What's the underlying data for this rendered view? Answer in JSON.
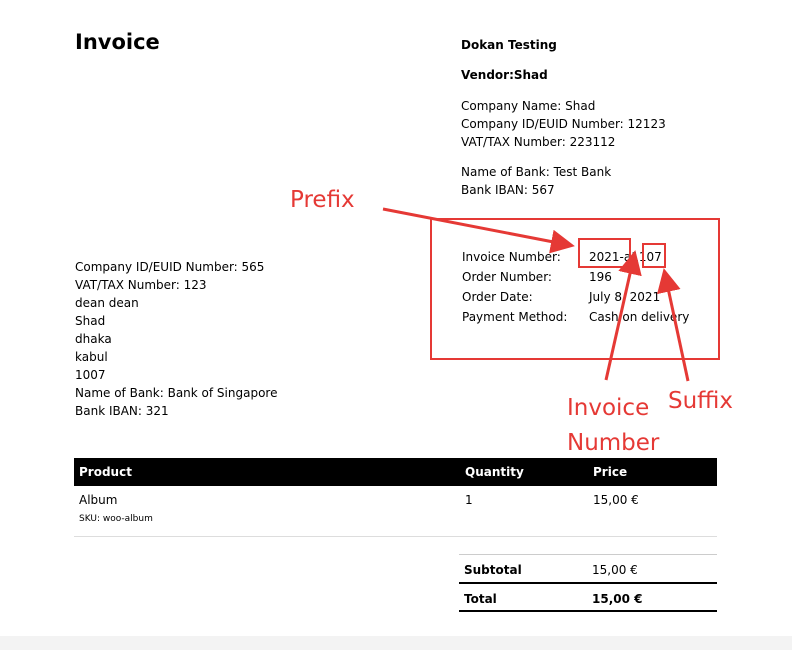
{
  "invoice": {
    "title": "Invoice",
    "shop_name": "Dokan Testing",
    "vendor": "Vendor:Shad",
    "vendor_details": [
      "Company Name: Shad",
      "Company ID/EUID Number: 12123",
      "VAT/TAX Number: 223112"
    ],
    "bank_details": [
      "Name of Bank: Test Bank",
      "Bank IBAN: 567"
    ],
    "billing_address": [
      "Company ID/EUID Number: 565",
      "VAT/TAX Number: 123",
      "dean dean",
      "Shad",
      "dhaka",
      "kabul",
      "1007",
      "Name of Bank: Bank of Singapore",
      "Bank IBAN: 321"
    ],
    "order_data": [
      {
        "label": "Invoice Number:",
        "value": "2021-a1107"
      },
      {
        "label": "Order Number:",
        "value": "196"
      },
      {
        "label": "Order Date:",
        "value": "July 8, 2021"
      },
      {
        "label": "Payment Method:",
        "value": "Cash on delivery"
      }
    ],
    "table": {
      "headers": {
        "product": "Product",
        "quantity": "Quantity",
        "price": "Price"
      },
      "items": [
        {
          "name": "Album",
          "sku": "SKU:  woo-album",
          "quantity": "1",
          "price": "15,00 €"
        }
      ]
    },
    "totals": [
      {
        "label": "Subtotal",
        "value": "15,00 €"
      },
      {
        "label": "Total",
        "value": "15,00 €"
      }
    ]
  },
  "annotations": {
    "prefix": "Prefix",
    "invoice_number_line1": "Invoice",
    "invoice_number_line2": "Number",
    "suffix": "Suffix",
    "color": "#e53935"
  }
}
